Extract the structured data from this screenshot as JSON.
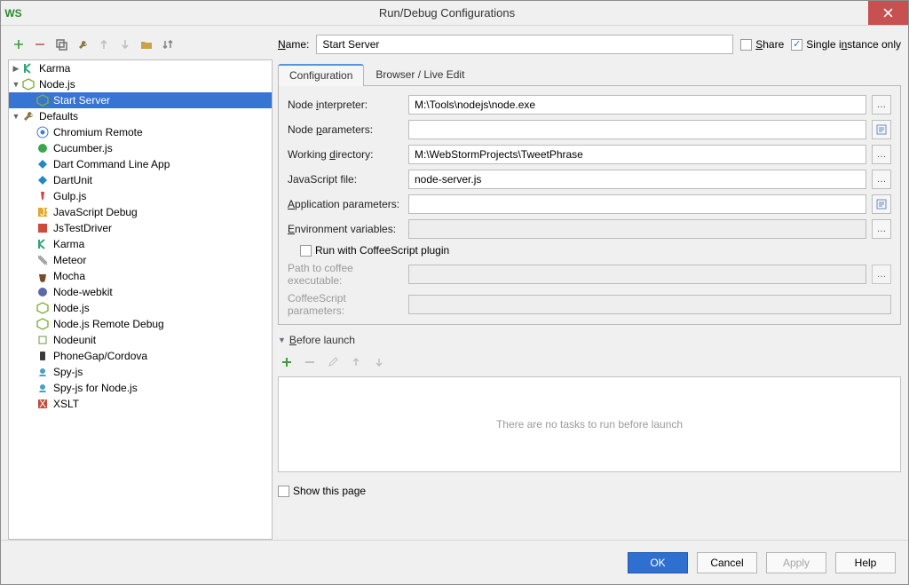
{
  "window": {
    "title": "Run/Debug Configurations",
    "app_icon": "WS"
  },
  "toolbar": {
    "items": [
      {
        "name": "add-icon",
        "glyph": "plus",
        "color": "#3a9c3a",
        "enabled": true
      },
      {
        "name": "remove-icon",
        "glyph": "minus",
        "color": "#c15b5b",
        "enabled": true
      },
      {
        "name": "copy-icon",
        "glyph": "copy",
        "color": "#7a7a7a",
        "enabled": true
      },
      {
        "name": "save-template-icon",
        "glyph": "wrench",
        "color": "#8c7a46",
        "enabled": true
      },
      {
        "name": "move-up-icon",
        "glyph": "arrow-up",
        "color": "#888",
        "enabled": false
      },
      {
        "name": "move-down-icon",
        "glyph": "arrow-down",
        "color": "#888",
        "enabled": false
      },
      {
        "name": "folder-icon",
        "glyph": "folder",
        "color": "#caa24a",
        "enabled": true
      },
      {
        "name": "sort-icon",
        "glyph": "sort",
        "color": "#888",
        "enabled": true
      }
    ]
  },
  "tree": {
    "nodes": [
      {
        "depth": 0,
        "expand": "right",
        "icon": "karma",
        "iconColor": "#2aa876",
        "label": "Karma"
      },
      {
        "depth": 0,
        "expand": "down",
        "icon": "node",
        "iconColor": "#7fb13c",
        "label": "Node.js"
      },
      {
        "depth": 1,
        "expand": "none",
        "icon": "node",
        "iconColor": "#7fb13c",
        "label": "Start Server",
        "selected": true
      },
      {
        "depth": 0,
        "expand": "down",
        "icon": "wrench",
        "iconColor": "#8c7a46",
        "label": "Defaults"
      },
      {
        "depth": 1,
        "expand": "none",
        "icon": "chrome",
        "iconColor": "#3d7be0",
        "label": "Chromium Remote"
      },
      {
        "depth": 1,
        "expand": "none",
        "icon": "cucumber",
        "iconColor": "#3aa64a",
        "label": "Cucumber.js"
      },
      {
        "depth": 1,
        "expand": "none",
        "icon": "dart",
        "iconColor": "#1f89c8",
        "label": "Dart Command Line App"
      },
      {
        "depth": 1,
        "expand": "none",
        "icon": "dart",
        "iconColor": "#1f89c8",
        "label": "DartUnit"
      },
      {
        "depth": 1,
        "expand": "none",
        "icon": "gulp",
        "iconColor": "#d04648",
        "label": "Gulp.js"
      },
      {
        "depth": 1,
        "expand": "none",
        "icon": "js",
        "iconColor": "#e0a92e",
        "label": "JavaScript Debug"
      },
      {
        "depth": 1,
        "expand": "none",
        "icon": "jstd",
        "iconColor": "#cf4a3a",
        "label": "JsTestDriver"
      },
      {
        "depth": 1,
        "expand": "none",
        "icon": "karma",
        "iconColor": "#2aa876",
        "label": "Karma"
      },
      {
        "depth": 1,
        "expand": "none",
        "icon": "meteor",
        "iconColor": "#888888",
        "label": "Meteor"
      },
      {
        "depth": 1,
        "expand": "none",
        "icon": "mocha",
        "iconColor": "#7a4a2a",
        "label": "Mocha"
      },
      {
        "depth": 1,
        "expand": "none",
        "icon": "nwk",
        "iconColor": "#5a6aa8",
        "label": "Node-webkit"
      },
      {
        "depth": 1,
        "expand": "none",
        "icon": "node",
        "iconColor": "#7fb13c",
        "label": "Node.js"
      },
      {
        "depth": 1,
        "expand": "none",
        "icon": "node",
        "iconColor": "#7fb13c",
        "label": "Node.js Remote Debug"
      },
      {
        "depth": 1,
        "expand": "none",
        "icon": "nodeunit",
        "iconColor": "#6a9a4a",
        "label": "Nodeunit"
      },
      {
        "depth": 1,
        "expand": "none",
        "icon": "pg",
        "iconColor": "#3a3a3a",
        "label": "PhoneGap/Cordova"
      },
      {
        "depth": 1,
        "expand": "none",
        "icon": "spy",
        "iconColor": "#49a0c4",
        "label": "Spy-js"
      },
      {
        "depth": 1,
        "expand": "none",
        "icon": "spy",
        "iconColor": "#49a0c4",
        "label": "Spy-js for Node.js"
      },
      {
        "depth": 1,
        "expand": "none",
        "icon": "xslt",
        "iconColor": "#c24a3a",
        "label": "XSLT"
      }
    ]
  },
  "name": {
    "label": "Name:",
    "value": "Start Server"
  },
  "share": {
    "label": "Share",
    "checked": false
  },
  "single": {
    "label": "Single instance only",
    "checked": true
  },
  "tabs": {
    "config": "Configuration",
    "browser": "Browser / Live Edit"
  },
  "form": {
    "node_interpreter": {
      "label": "Node interpreter:",
      "value": "M:\\Tools\\nodejs\\node.exe",
      "u": "i"
    },
    "node_parameters": {
      "label": "Node parameters:",
      "value": "",
      "u": "p"
    },
    "working_dir": {
      "label": "Working directory:",
      "value": "M:\\WebStormProjects\\TweetPhrase",
      "u": "d"
    },
    "js_file": {
      "label": "JavaScript file:",
      "value": "node-server.js"
    },
    "app_params": {
      "label": "Application parameters:",
      "value": "",
      "u": "A"
    },
    "env_vars": {
      "label": "Environment variables:",
      "value": "",
      "u": "E"
    },
    "run_coffee": {
      "label": "Run with CoffeeScript plugin",
      "checked": false
    },
    "coffee_exec": {
      "label": "Path to coffee executable:",
      "value": ""
    },
    "coffee_params": {
      "label": "CoffeeScript parameters:",
      "value": ""
    }
  },
  "before_launch": {
    "title": "Before launch",
    "empty_text": "There are no tasks to run before launch",
    "show_page": "Show this page"
  },
  "buttons": {
    "ok": "OK",
    "cancel": "Cancel",
    "apply": "Apply",
    "help": "Help"
  }
}
